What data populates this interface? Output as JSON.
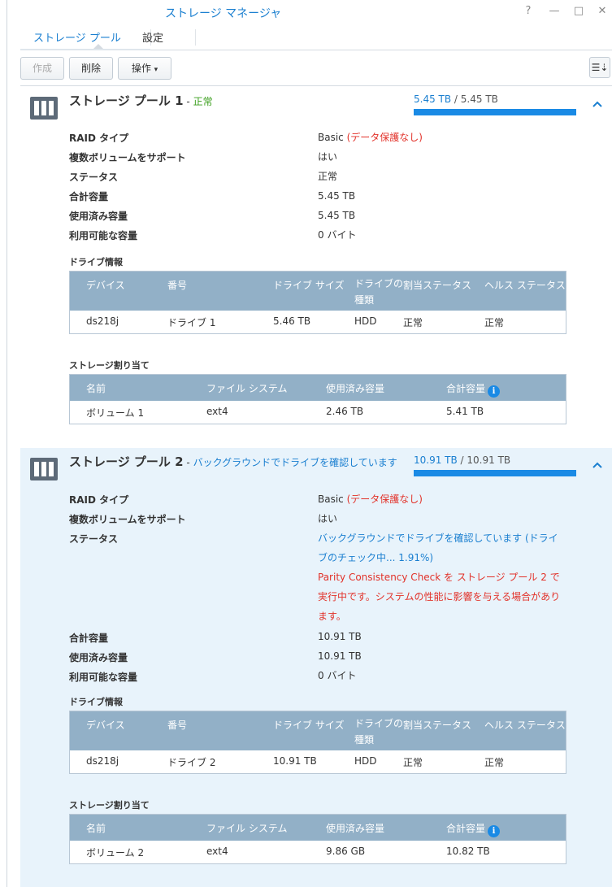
{
  "window": {
    "title": "ストレージ マネージャ",
    "help": "?",
    "minimize": "—",
    "maximize": "□",
    "close": "✕"
  },
  "tabs": [
    {
      "label": "ストレージ プール",
      "active": true
    },
    {
      "label": "設定",
      "active": false
    }
  ],
  "toolbar": {
    "create_label": "作成",
    "delete_label": "削除",
    "action_label": "操作",
    "action_caret": "▾",
    "sort_icon": "☰⇣"
  },
  "labels": {
    "raid_type": "RAID タイプ",
    "multi_volume": "複数ボリュームをサポート",
    "status": "ステータス",
    "total_capacity": "合計容量",
    "used_capacity": "使用済み容量",
    "available_capacity": "利用可能な容量",
    "drive_info": "ドライブ情報",
    "storage_allocation": "ストレージ割り当て"
  },
  "drive_columns": [
    "デバイス",
    "番号",
    "ドライブ サイズ",
    "ドライブの種類",
    "割当ステータス",
    "ヘルス ステータス"
  ],
  "alloc_columns": [
    "名前",
    "ファイル システム",
    "使用済み容量",
    "合計容量"
  ],
  "pools": [
    {
      "title": "ストレージ プール 1",
      "sep": " - ",
      "subtitle": "正常",
      "usage_used": "5.45 TB",
      "usage_total": " / 5.45 TB",
      "usage_fraction": 1.0,
      "raid_type": "Basic",
      "raid_note": " (データ保護なし)",
      "multi_volume": "はい",
      "status": "正常",
      "total": "5.45 TB",
      "used": "5.45 TB",
      "available": "0 バイト",
      "drives": [
        {
          "device": "ds218j",
          "number": "ドライブ 1",
          "size": "5.46 TB",
          "type": "HDD",
          "alloc": "正常",
          "health": "正常"
        }
      ],
      "volumes": [
        {
          "name": "ボリューム 1",
          "fs": "ext4",
          "used": "2.46 TB",
          "total": "5.41 TB"
        }
      ]
    },
    {
      "title": "ストレージ プール 2",
      "sep": " - ",
      "subtitle": "バックグラウンドでドライブを確認しています",
      "usage_used": "10.91 TB",
      "usage_total": " / 10.91 TB",
      "usage_fraction": 1.0,
      "raid_type": "Basic",
      "raid_note": " (データ保護なし)",
      "multi_volume": "はい",
      "status_line1": "バックグラウンドでドライブを確認しています (ドライ",
      "status_line2": "ブのチェック中... 1.91%)",
      "warning_line1": "Parity Consistency Check を ストレージ プール 2 で",
      "warning_line2": "実行中です。システムの性能に影響を与える場合があり",
      "warning_line3": "ます。",
      "total": "10.91 TB",
      "used": "10.91 TB",
      "available": "0 バイト",
      "drives": [
        {
          "device": "ds218j",
          "number": "ドライブ 2",
          "size": "10.91 TB",
          "type": "HDD",
          "alloc": "正常",
          "health": "正常"
        }
      ],
      "volumes": [
        {
          "name": "ボリューム 2",
          "fs": "ext4",
          "used": "9.86 GB",
          "total": "10.82 TB"
        }
      ]
    }
  ]
}
